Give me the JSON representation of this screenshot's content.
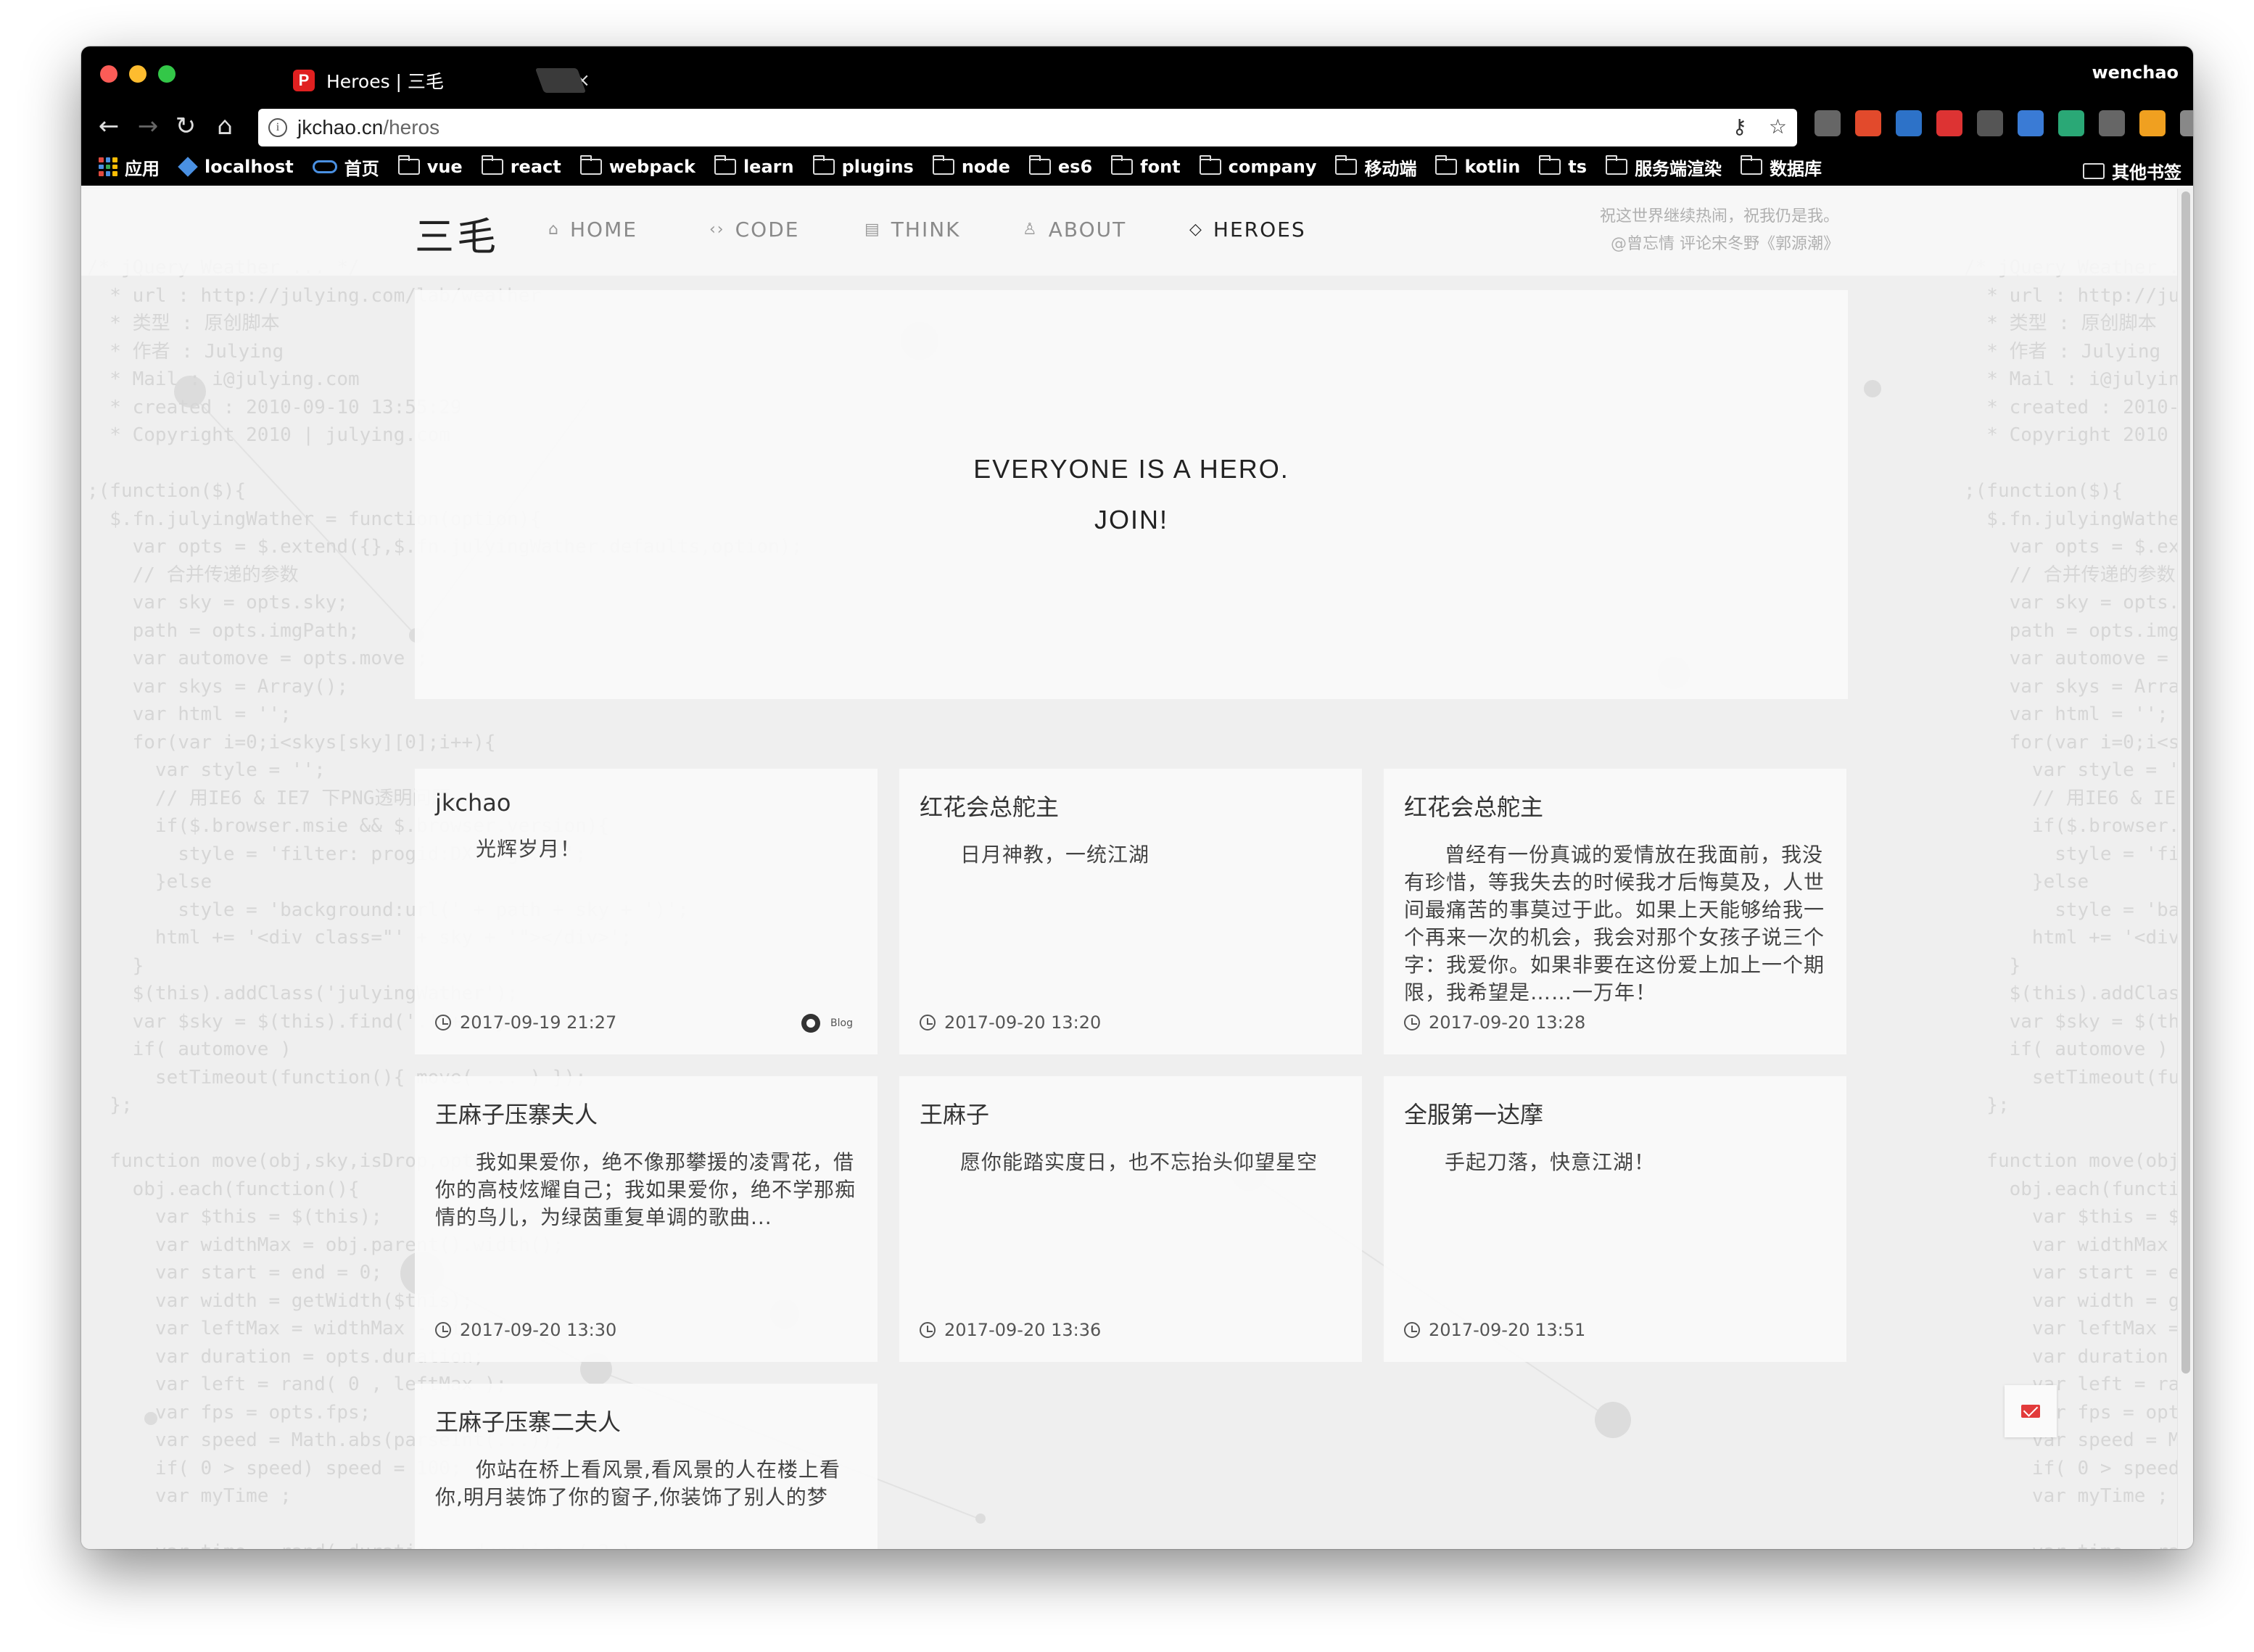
{
  "browser": {
    "tab_title": "Heroes | 三毛",
    "tab_favicon": "P",
    "tab_close": "×",
    "profile_name": "wenchao",
    "url_host": "jkchao.cn",
    "url_path": "/heros",
    "extensions": [
      "tag-icon",
      "red-square-icon",
      "new-badge-icon",
      "count-badge-icon",
      "pen-icon",
      "translate-icon",
      "vue-devtools-icon",
      "column-icon",
      "puzzle-icon",
      "pages-icon",
      "menu-icon"
    ],
    "bookmarks": [
      {
        "label": "应用",
        "icon": "apps-grid-icon"
      },
      {
        "label": "localhost",
        "icon": "cube-icon"
      },
      {
        "label": "首页",
        "icon": "cloud-icon"
      },
      {
        "label": "vue",
        "icon": "folder-icon"
      },
      {
        "label": "react",
        "icon": "folder-icon"
      },
      {
        "label": "webpack",
        "icon": "folder-icon"
      },
      {
        "label": "learn",
        "icon": "folder-icon"
      },
      {
        "label": "plugins",
        "icon": "folder-icon"
      },
      {
        "label": "node",
        "icon": "folder-icon"
      },
      {
        "label": "es6",
        "icon": "folder-icon"
      },
      {
        "label": "font",
        "icon": "folder-icon"
      },
      {
        "label": "company",
        "icon": "folder-icon"
      },
      {
        "label": "移动端",
        "icon": "folder-icon"
      },
      {
        "label": "kotlin",
        "icon": "folder-icon"
      },
      {
        "label": "ts",
        "icon": "folder-icon"
      },
      {
        "label": "服务端渲染",
        "icon": "folder-icon"
      },
      {
        "label": "数据库",
        "icon": "folder-icon"
      }
    ],
    "other_bookmarks": "其他书签"
  },
  "site": {
    "logo": "三毛",
    "nav": [
      {
        "label": "HOME",
        "icon": "home-icon"
      },
      {
        "label": "CODE",
        "icon": "code-icon"
      },
      {
        "label": "THINK",
        "icon": "book-icon"
      },
      {
        "label": "ABOUT",
        "icon": "user-icon"
      },
      {
        "label": "HEROES",
        "icon": "diamond-icon",
        "active": true
      }
    ],
    "quote_line1": "祝这世界继续热闹，祝我仍是我。",
    "quote_line2": "@曾忘情 评论宋冬野《郭源潮》"
  },
  "hero": {
    "line1": "EVERYONE IS A HERO.",
    "line2": "JOIN!"
  },
  "cards": [
    {
      "name": "jkchao",
      "text": "光辉岁月！",
      "time": "2017-09-19 21:27",
      "blog": "Blog"
    },
    {
      "name": "红花会总舵主",
      "text": "日月神教，一统江湖",
      "time": "2017-09-20 13:20"
    },
    {
      "name": "红花会总舵主",
      "text": "曾经有一份真诚的爱情放在我面前，我没有珍惜，等我失去的时候我才后悔莫及，人世间最痛苦的事莫过于此。如果上天能够给我一个再来一次的机会，我会对那个女孩子说三个字：我爱你。如果非要在这份爱上加上一个期限，我希望是……一万年！",
      "time": "2017-09-20 13:28"
    },
    {
      "name": "王麻子压寨夫人",
      "text": "我如果爱你，绝不像那攀援的凌霄花，借你的高枝炫耀自己；我如果爱你，绝不学那痴情的鸟儿，为绿茵重复单调的歌曲...",
      "time": "2017-09-20 13:30"
    },
    {
      "name": "王麻子",
      "text": "愿你能踏实度日，也不忘抬头仰望星空",
      "time": "2017-09-20 13:36"
    },
    {
      "name": "全服第一达摩",
      "text": "手起刀落，快意江湖！",
      "time": "2017-09-20 13:51"
    },
    {
      "name": "王麻子压寨二夫人",
      "text": "你站在桥上看风景,看风景的人在楼上看你,明月装饰了你的窗子,你装饰了别人的梦",
      "time": ""
    }
  ],
  "colors": {
    "accent": "#222222",
    "nav_inactive": "#8a8a8a",
    "mail_button": "#e23b3b"
  }
}
